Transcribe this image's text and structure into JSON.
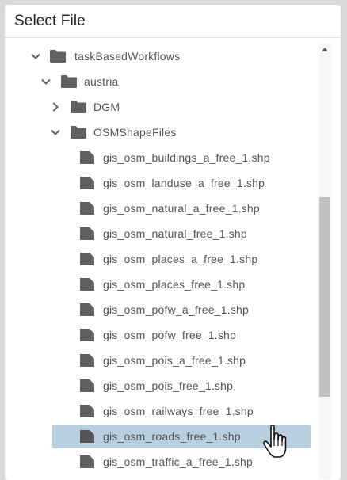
{
  "dialog": {
    "title": "Select File"
  },
  "tree": {
    "items": [
      {
        "label": "taskBasedWorkflows",
        "type": "folder",
        "expanded": true,
        "icon": "folder-icon"
      },
      {
        "label": "austria",
        "type": "folder",
        "expanded": true,
        "icon": "folder-icon"
      },
      {
        "label": "DGM",
        "type": "folder",
        "expanded": false,
        "icon": "folder-icon"
      },
      {
        "label": "OSMShapeFiles",
        "type": "folder",
        "expanded": true,
        "icon": "folder-icon"
      },
      {
        "label": "gis_osm_buildings_a_free_1.shp",
        "type": "file",
        "icon": "file-icon"
      },
      {
        "label": "gis_osm_landuse_a_free_1.shp",
        "type": "file",
        "icon": "file-icon"
      },
      {
        "label": "gis_osm_natural_a_free_1.shp",
        "type": "file",
        "icon": "file-icon"
      },
      {
        "label": "gis_osm_natural_free_1.shp",
        "type": "file",
        "icon": "file-icon"
      },
      {
        "label": "gis_osm_places_a_free_1.shp",
        "type": "file",
        "icon": "file-icon"
      },
      {
        "label": "gis_osm_places_free_1.shp",
        "type": "file",
        "icon": "file-icon"
      },
      {
        "label": "gis_osm_pofw_a_free_1.shp",
        "type": "file",
        "icon": "file-icon"
      },
      {
        "label": "gis_osm_pofw_free_1.shp",
        "type": "file",
        "icon": "file-icon"
      },
      {
        "label": "gis_osm_pois_a_free_1.shp",
        "type": "file",
        "icon": "file-icon"
      },
      {
        "label": "gis_osm_pois_free_1.shp",
        "type": "file",
        "icon": "file-icon"
      },
      {
        "label": "gis_osm_railways_free_1.shp",
        "type": "file",
        "icon": "file-icon"
      },
      {
        "label": "gis_osm_roads_free_1.shp",
        "type": "file",
        "icon": "file-icon",
        "selected": true
      },
      {
        "label": "gis_osm_traffic_a_free_1.shp",
        "type": "file",
        "icon": "file-icon"
      }
    ]
  },
  "colors": {
    "selected_bg": "#b8cfe0",
    "icon": "#616161",
    "text": "#555555",
    "scroll_thumb": "#c1c1c1"
  },
  "cursor": {
    "icon": "hand-pointer-icon"
  }
}
